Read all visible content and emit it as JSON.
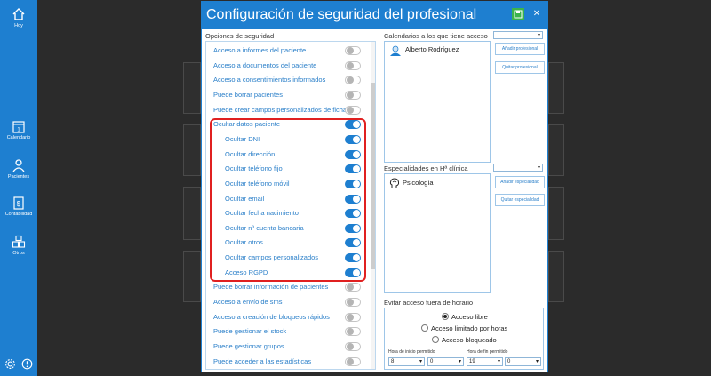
{
  "sidebar": {
    "items": [
      {
        "label": "Hoy",
        "icon": "home-icon"
      },
      {
        "label": "Calendario",
        "icon": "calendar-icon"
      },
      {
        "label": "Pacientes",
        "icon": "user-icon"
      },
      {
        "label": "Contabilidad",
        "icon": "accounting-icon"
      },
      {
        "label": "Otros",
        "icon": "cubes-icon"
      }
    ],
    "calendar_day": "1"
  },
  "dialog": {
    "title": "Configuración de seguridad del profesional",
    "close_glyph": "✕",
    "security_section_label": "Opciones de seguridad",
    "options": [
      {
        "label": "Acceso a informes del paciente",
        "on": false
      },
      {
        "label": "Acceso a documentos del paciente",
        "on": false
      },
      {
        "label": "Acceso a consentimientos informados",
        "on": false
      },
      {
        "label": "Puede borrar pacientes",
        "on": false
      },
      {
        "label": "Puede crear campos personalizados de ficha",
        "on": false
      },
      {
        "label": "Ocultar datos paciente",
        "on": true
      },
      {
        "label": "Ocultar DNI",
        "on": true
      },
      {
        "label": "Ocultar dirección",
        "on": true
      },
      {
        "label": "Ocultar teléfono fijo",
        "on": true
      },
      {
        "label": "Ocultar teléfono móvil",
        "on": true
      },
      {
        "label": "Ocultar email",
        "on": true
      },
      {
        "label": "Ocultar fecha nacimiento",
        "on": true
      },
      {
        "label": "Ocultar nº cuenta bancaria",
        "on": true
      },
      {
        "label": "Ocultar otros",
        "on": true
      },
      {
        "label": "Ocultar campos personalizados",
        "on": true
      },
      {
        "label": "Acceso RGPD",
        "on": true
      },
      {
        "label": "Puede borrar información de pacientes",
        "on": false
      },
      {
        "label": "Acceso a envío de sms",
        "on": false
      },
      {
        "label": "Acceso a creación de bloqueos rápidos",
        "on": false
      },
      {
        "label": "Puede gestionar el stock",
        "on": false
      },
      {
        "label": "Puede gestionar grupos",
        "on": false
      },
      {
        "label": "Puede acceder a las estadísticas",
        "on": false
      }
    ],
    "calendars": {
      "label": "Calendarios a los que tiene acceso",
      "items": [
        "Alberto Rodríguez"
      ],
      "add_button": "Añadir profesional",
      "remove_button": "Quitar profesional"
    },
    "specialties": {
      "label": "Especialidades en Hª clínica",
      "items": [
        "Psicología"
      ],
      "add_button": "Añadir especialidad",
      "remove_button": "Quitar especialidad"
    },
    "schedule": {
      "label": "Evitar acceso fuera de horario",
      "options": [
        "Acceso libre",
        "Acceso limitado por horas",
        "Acceso bloqueado"
      ],
      "selected": "Acceso libre",
      "start_label": "Hora de inicio permitido",
      "end_label": "Hora de fin permitido",
      "start_hour": "8",
      "start_minute": "0",
      "end_hour": "19",
      "end_minute": "0"
    }
  },
  "colors": {
    "accent": "#1e7fd0",
    "highlight": "#e02020",
    "save": "#3cb44b"
  }
}
